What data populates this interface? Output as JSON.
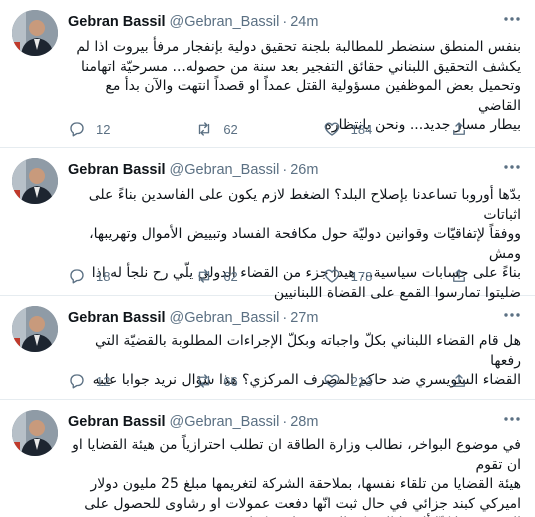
{
  "tweets": [
    {
      "name": "Gebran Bassil",
      "handle": "@Gebran_Bassil",
      "dot": "·",
      "time": "24m",
      "text": "بنفس المنطق سنضطر للمطالبة بلجنة تحقيق دولية بإنفجار مرفأ بيروت اذا لم\nيكشف التحقيق اللبناني حقائق التفجير بعد سنة من حصوله... مسرحيّة اتهامنا\nوتحميل بعض الموظفين مسؤولية القتل عمداً او قصداً انتهت والآن بدأ مع القاضي\nبيطار مسار جديد... ونحن بانتظاره",
      "replies": "12",
      "retweets": "62",
      "likes": "184"
    },
    {
      "name": "Gebran Bassil",
      "handle": "@Gebran_Bassil",
      "dot": "·",
      "time": "26m",
      "text": "بدّها أوروبا تساعدنا بإصلاح البلد؟ الضغط لازم يكون على الفاسدين  بناءً على اثباتات\nووفقاً لإتفاقيّات وقوانين دوليّة حول مكافحة الفساد وتبييض الأموال وتهريبها، ومش\nبناءً على حسابات سياسية... هيدا جزء من القضاء الدولي يلّي رح نلجأ له اذا\nضليتوا تمارسوا القمع على القضاة اللبنانيين",
      "replies": "18",
      "retweets": "62",
      "likes": "178"
    },
    {
      "name": "Gebran Bassil",
      "handle": "@Gebran_Bassil",
      "dot": "·",
      "time": "27m",
      "text": "هل قام القضاء اللبناني بكلّ واجباته وبكلّ الإجراءات المطلوبة بالقضيّة التي رفعها\nالقضاء السويسري ضد حاكم المصرف المركزي؟ هذا سؤال نريد جوابا عليه",
      "replies": "12",
      "retweets": "66",
      "likes": "213"
    },
    {
      "name": "Gebran Bassil",
      "handle": "@Gebran_Bassil",
      "dot": "·",
      "time": "28m",
      "text": "في موضوع البواخر، نطالب وزارة الطاقة ان تطلب احترازياً من هيئة القضايا او ان تقوم\nهيئة القضايا من تلقاء نفسها، بملاحقة الشركة لتغريمها مبلغ 25 مليون دولار\nاميركي كبند جزائي في حال ثبت انّها دفعت عمولات او رشاوى للحصول على\nالعقد، ونحنا كنّا ألزمنا الشركة التوقيع على هكذا تعهّد",
      "replies": "",
      "retweets": "",
      "likes": ""
    }
  ],
  "icons": {
    "reply": "reply-icon",
    "retweet": "retweet-icon",
    "like": "like-icon",
    "share": "share-icon",
    "more": "more-icon"
  },
  "colors": {
    "text": "#0f1419",
    "secondary": "#5b7083",
    "divider": "#e6ecf0"
  }
}
